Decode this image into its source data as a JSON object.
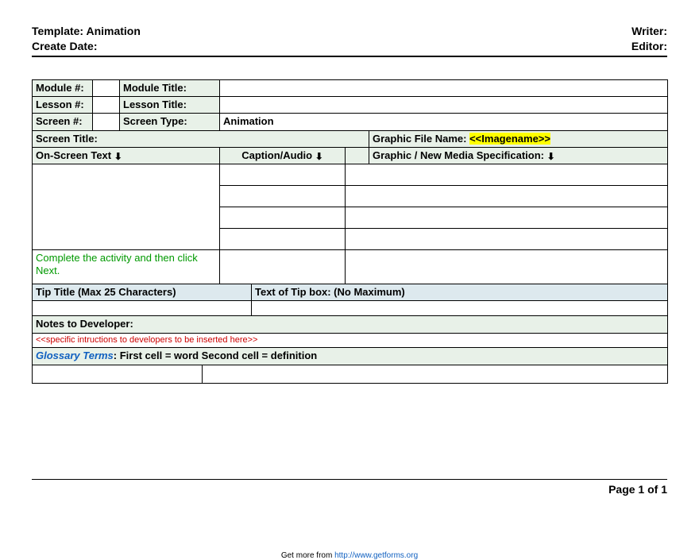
{
  "header": {
    "template_label": "Template: Animation",
    "writer_label": "Writer:",
    "create_date_label": "Create Date:",
    "editor_label": "Editor:"
  },
  "row1": {
    "module_num": "Module #:",
    "module_title": "Module Title:"
  },
  "row2": {
    "lesson_num": "Lesson #:",
    "lesson_title": "Lesson Title:"
  },
  "row3": {
    "screen_num": "Screen #:",
    "screen_type": "Screen Type:",
    "screen_type_value": "Animation"
  },
  "row4": {
    "screen_title": "Screen Title:",
    "graphic_file": "Graphic File Name: ",
    "graphic_file_value": "<<Imagename>>"
  },
  "row5": {
    "onscreen": "On-Screen Text ",
    "caption": "Caption/Audio ",
    "spec": "Graphic / New Media Specification: "
  },
  "content": {
    "instruction": "Complete the activity and then click Next."
  },
  "tip": {
    "title_label": "Tip Title (Max 25 Characters)",
    "text_label": "Text of Tip box: (No Maximum)"
  },
  "notes": {
    "label": "Notes to Developer:",
    "placeholder": "<<specific intructions to developers to be inserted here>>"
  },
  "glossary": {
    "label": "Glossary Terms",
    "rest": ": First cell = word Second cell = definition"
  },
  "footer": {
    "page": "Page 1 of 1",
    "getmore": "Get more from ",
    "link": "http://www.getforms.org"
  }
}
